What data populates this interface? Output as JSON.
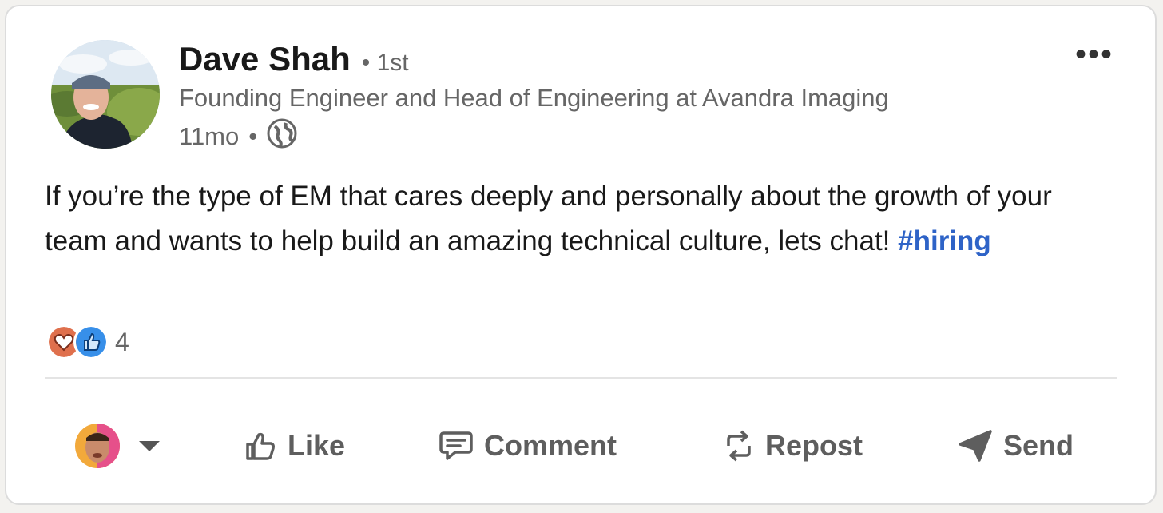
{
  "post": {
    "author_name": "Dave Shah",
    "degree": "1st",
    "headline": "Founding Engineer and Head of Engineering at Avandra Imaging",
    "age": "11mo",
    "visibility_icon": "globe-icon",
    "text_before": "If you’re the type of EM that cares deeply and personally about the growth of your team and wants to help build an amazing technical culture, lets chat! ",
    "hashtag": "#hiring",
    "reaction_icons": [
      "love-icon",
      "like-icon"
    ],
    "reaction_count": "4"
  },
  "actions": {
    "like": "Like",
    "comment": "Comment",
    "repost": "Repost",
    "send": "Send"
  },
  "colors": {
    "hashtag": "#2e63c7",
    "like_reaction": "#378fe9",
    "love_reaction": "#df704d"
  }
}
